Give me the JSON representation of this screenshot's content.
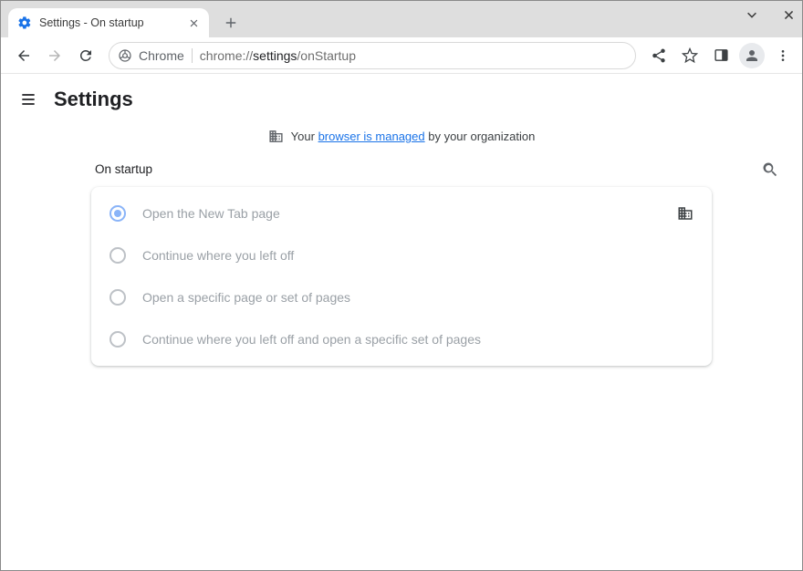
{
  "browser": {
    "tab_title": "Settings - On startup",
    "omnibox_prefix": "Chrome",
    "omnibox_url_scheme": "chrome://",
    "omnibox_url_bold": "settings",
    "omnibox_url_rest": "/onStartup"
  },
  "page": {
    "header_title": "Settings",
    "managed_banner": {
      "pre": "Your ",
      "link": "browser is managed",
      "post": " by your organization"
    },
    "section_heading": "On startup",
    "startup_options": [
      {
        "label": "Open the New Tab page",
        "selected": true,
        "policy_icon": true
      },
      {
        "label": "Continue where you left off",
        "selected": false,
        "policy_icon": false
      },
      {
        "label": "Open a specific page or set of pages",
        "selected": false,
        "policy_icon": false
      },
      {
        "label": "Continue where you left off and open a specific set of pages",
        "selected": false,
        "policy_icon": false
      }
    ]
  }
}
